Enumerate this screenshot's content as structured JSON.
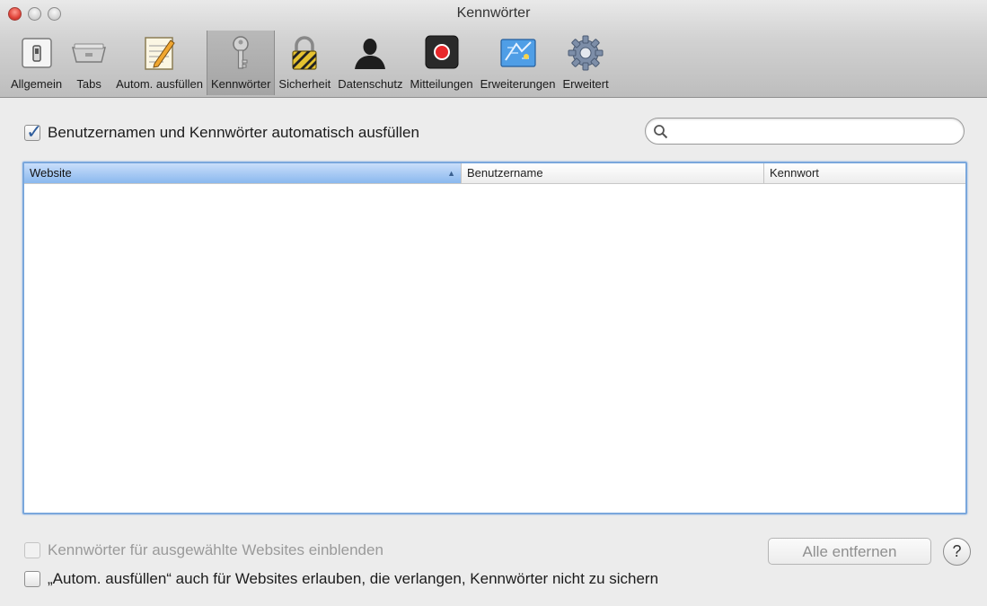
{
  "window": {
    "title": "Kennwörter"
  },
  "toolbar": {
    "items": [
      {
        "label": "Allgemein",
        "icon": "general-switch-icon"
      },
      {
        "label": "Tabs",
        "icon": "tabs-icon"
      },
      {
        "label": "Autom. ausfüllen",
        "icon": "autofill-pencil-icon"
      },
      {
        "label": "Kennwörter",
        "icon": "key-icon",
        "selected": true
      },
      {
        "label": "Sicherheit",
        "icon": "lock-icon"
      },
      {
        "label": "Datenschutz",
        "icon": "person-silhouette-icon"
      },
      {
        "label": "Mitteilungen",
        "icon": "notification-record-icon"
      },
      {
        "label": "Erweiterungen",
        "icon": "puzzle-extension-icon"
      },
      {
        "label": "Erweitert",
        "icon": "gear-icon"
      }
    ]
  },
  "autofill": {
    "label": "Benutzernamen und Kennwörter automatisch ausfüllen",
    "checked": true
  },
  "search": {
    "value": "",
    "placeholder": ""
  },
  "table": {
    "columns": [
      "Website",
      "Benutzername",
      "Kennwort"
    ],
    "sort_column": "Website",
    "sort_direction": "ascending",
    "rows": []
  },
  "show_passwords": {
    "label": "Kennwörter für ausgewählte Websites einblenden",
    "checked": false,
    "enabled": false
  },
  "remove_all": {
    "label": "Alle entfernen",
    "enabled": false
  },
  "help": {
    "label": "?"
  },
  "allow_autofill": {
    "label": "„Autom. ausfüllen“ auch für Websites erlauben, die verlangen, Kennwörter nicht zu sichern",
    "checked": false
  },
  "colors": {
    "selection_blue": "#8ab8ee",
    "focus_ring": "#7aa7dc",
    "close_red": "#e0443a",
    "record_red": "#e8282b"
  }
}
